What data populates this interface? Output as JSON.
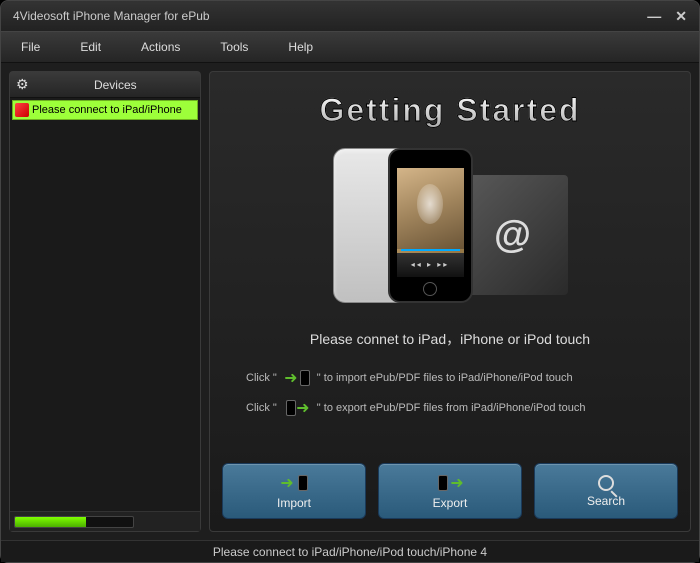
{
  "title": "4Videosoft iPhone Manager for ePub",
  "menu": {
    "file": "File",
    "edit": "Edit",
    "actions": "Actions",
    "tools": "Tools",
    "help": "Help"
  },
  "sidebar": {
    "title": "Devices",
    "item": "Please connect to iPad/iPhone"
  },
  "main": {
    "heading": "Getting Started",
    "connect_msg": "Please connet to iPad，iPhone or iPod touch",
    "instr_click": "Click \"",
    "instr_import": "\" to import ePub/PDF files to iPad/iPhone/iPod touch",
    "instr_export": "\" to export ePub/PDF files from iPad/iPhone/iPod touch"
  },
  "buttons": {
    "import": "Import",
    "export": "Export",
    "search": "Search"
  },
  "status": "Please connect to iPad/iPhone/iPod touch/iPhone 4"
}
